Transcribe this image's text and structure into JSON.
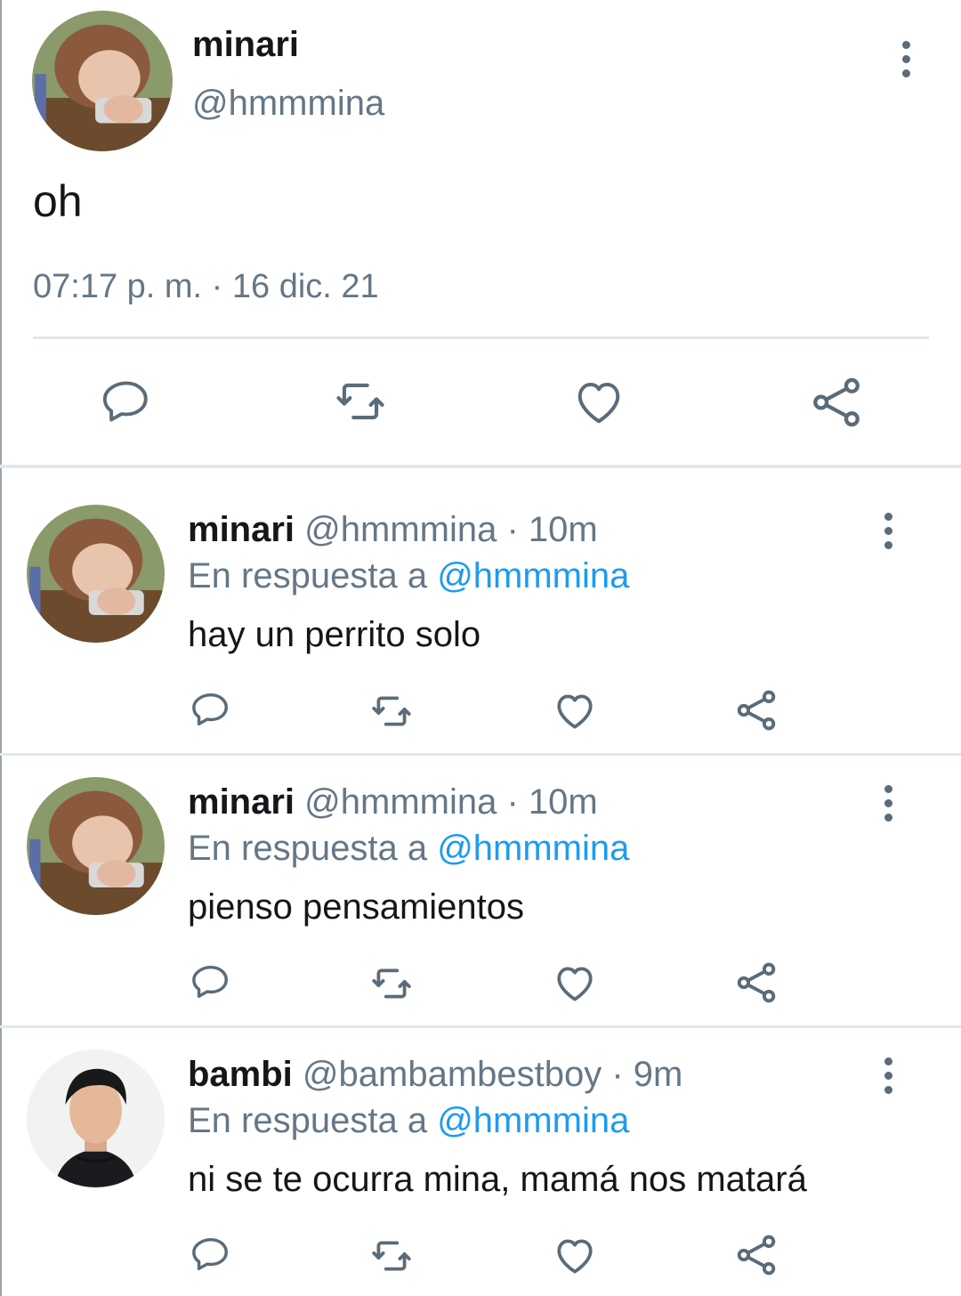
{
  "main_tweet": {
    "author": {
      "name": "minari",
      "handle": "@hmmmina"
    },
    "text": "oh",
    "timestamp": "07:17 p. m. · 16 dic. 21",
    "actions": [
      "reply-icon",
      "retweet-icon",
      "like-icon",
      "share-icon"
    ]
  },
  "replies": [
    {
      "name": "minari",
      "handle": "@hmmmina",
      "time": "· 10m",
      "reply_prefix": "En respuesta a",
      "reply_to": "@hmmmina",
      "text": "hay un perrito solo"
    },
    {
      "name": "minari",
      "handle": "@hmmmina",
      "time": "· 10m",
      "reply_prefix": "En respuesta a",
      "reply_to": "@hmmmina",
      "text": "pienso pensamientos"
    },
    {
      "name": "bambi",
      "handle": "@bambambestboy",
      "time": "· 9m",
      "reply_prefix": "En respuesta a",
      "reply_to": "@hmmmina",
      "text": "ni se te ocurra mina, mamá nos matará"
    }
  ],
  "colors": {
    "accent": "#1d9bf0",
    "muted": "#657786",
    "icon": "#5b6b78",
    "divider": "#e1e8ed"
  }
}
